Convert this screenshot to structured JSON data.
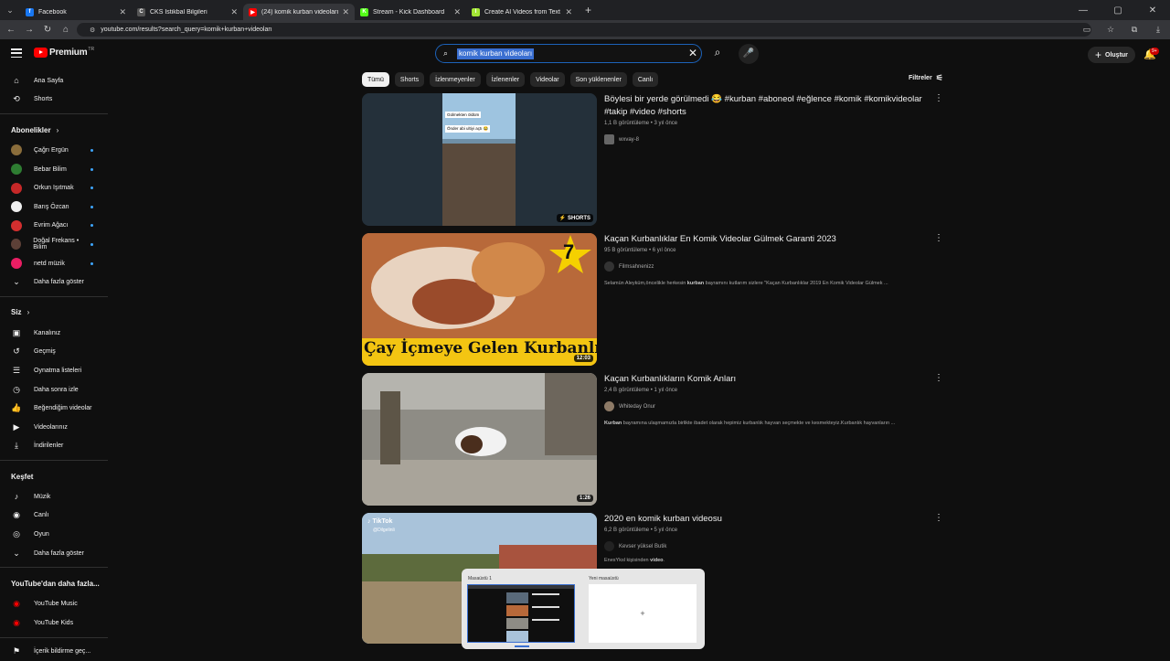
{
  "browser": {
    "tabs": [
      {
        "title": "Facebook",
        "color": "#1877f2",
        "glyph": "f",
        "active": false
      },
      {
        "title": "CKS İstikbal Bilgileri",
        "color": "#555555",
        "glyph": "C",
        "active": false
      },
      {
        "title": "(24) komik kurban videoları - Yo",
        "color": "#ff0000",
        "glyph": "▶",
        "active": true
      },
      {
        "title": "Stream - Kick Dashboard",
        "color": "#53fc18",
        "glyph": "K",
        "active": false
      },
      {
        "title": "Create AI Videos from Text & In",
        "color": "#a3e635",
        "glyph": "I",
        "active": false
      }
    ],
    "url": "youtube.com/results?search_query=komik+kurban+videoları"
  },
  "header": {
    "logo_text": "Premium",
    "country": "TR",
    "search_value": "komik kurban videoları",
    "create_label": "Oluştur",
    "notif_count": "9+"
  },
  "sidebar": {
    "main": [
      {
        "label": "Ana Sayfa",
        "icon": "home-icon",
        "glyph": "⌂"
      },
      {
        "label": "Shorts",
        "icon": "shorts-icon",
        "glyph": "⟲"
      }
    ],
    "subs_title": "Abonelikler",
    "subs": [
      {
        "label": "Çağrı Ergün",
        "color": "#8a6d3b"
      },
      {
        "label": "Bebar Bilim",
        "color": "#2e7d32"
      },
      {
        "label": "Orkun Işıtmak",
        "color": "#c62828"
      },
      {
        "label": "Barış Özcan",
        "color": "#eeeeee"
      },
      {
        "label": "Evrim Ağacı",
        "color": "#d32f2f"
      },
      {
        "label": "Doğal Frekans • Bilim",
        "color": "#5d4037"
      },
      {
        "label": "netd müzik",
        "color": "#e91e63"
      }
    ],
    "show_more": "Daha fazla göster",
    "you_title": "Siz",
    "you": [
      {
        "label": "Kanalınız",
        "icon": "channel-icon",
        "glyph": "▣"
      },
      {
        "label": "Geçmiş",
        "icon": "history-icon",
        "glyph": "↺"
      },
      {
        "label": "Oynatma listeleri",
        "icon": "playlists-icon",
        "glyph": "☰"
      },
      {
        "label": "Daha sonra izle",
        "icon": "watch-later-icon",
        "glyph": "◷"
      },
      {
        "label": "Beğendiğim videolar",
        "icon": "like-icon",
        "glyph": "👍"
      },
      {
        "label": "Videolarınız",
        "icon": "your-videos-icon",
        "glyph": "▶"
      },
      {
        "label": "İndirilenler",
        "icon": "download-icon",
        "glyph": "⤓"
      }
    ],
    "explore_title": "Keşfet",
    "explore": [
      {
        "label": "Müzik",
        "icon": "music-icon",
        "glyph": "♪"
      },
      {
        "label": "Canlı",
        "icon": "live-icon",
        "glyph": "◉"
      },
      {
        "label": "Oyun",
        "icon": "gaming-icon",
        "glyph": "◎"
      }
    ],
    "show_more2": "Daha fazla göster",
    "more_title": "YouTube'dan daha fazla...",
    "more": [
      {
        "label": "YouTube Music",
        "color": "#ff0000"
      },
      {
        "label": "YouTube Kids",
        "color": "#ff0000"
      }
    ],
    "report": "İçerik bildirme geç..."
  },
  "chips": [
    "Tümü",
    "Shorts",
    "İzlenmeyenler",
    "İzlenenler",
    "Videolar",
    "Son yüklenenler",
    "Canlı"
  ],
  "filters_label": "Filtreler",
  "videos": [
    {
      "title": "Böylesi bir yerde görülmedi 😂 #kurban #aboneol #eğlence #komik #komikvideolar #takip #video #shorts",
      "meta": "1,1 B görüntüleme • 3 yıl önce",
      "channel": "wxvay-8",
      "badge": "SHORTS",
      "desc_pre": "",
      "desc_bold": "",
      "desc_post": "",
      "overlay1": "Gülmekten öldüm",
      "overlay2": "Önder abi ultiyi açtı 😂"
    },
    {
      "title": "Kaçan Kurbanlıklar En Komik Videolar Gülmek Garanti 2023",
      "meta": "95 B görüntüleme • 6 yıl önce",
      "channel": "Filmsahnenizz",
      "badge": "12:03",
      "desc_pre": "Selamün Aleyküm,öncelikle herkesin ",
      "desc_bold": "kurban",
      "desc_post": " bayramını kutlarım sizlere \"Kaçan Kurbanlıklar 2019 En Komik Videolar Gülmek ...",
      "caption": "Çay İçmeye Gelen Kurbanlık",
      "star": "7"
    },
    {
      "title": "Kaçan Kurbanlıkların Komik Anları",
      "meta": "2,4 B görüntüleme • 1 yıl önce",
      "channel": "Whiteday Onur",
      "badge": "1:26",
      "desc_pre": "",
      "desc_bold": "Kurban",
      "desc_post": " bayramına ulaşmamızla birlikte ibadet olarak hepimiz kurbanlık hayvan seçmekte ve kesmekteyiz.Kurbanlık hayvanların ..."
    },
    {
      "title": "2020 en komik kurban videosu",
      "meta": "6,2 B görüntüleme • 5 yıl önce",
      "channel": "Kevser yüksel Butik",
      "badge": "",
      "desc_pre": "EnesYksl kişisinden ",
      "desc_bold": "video",
      "desc_post": ".",
      "tiktok": "TikTok",
      "tiktok_handle": "@Dilgelinli"
    }
  ],
  "desktops": {
    "label1": "Masaüstü 1",
    "label2": "Yeni masaüstü",
    "plus": "+"
  }
}
